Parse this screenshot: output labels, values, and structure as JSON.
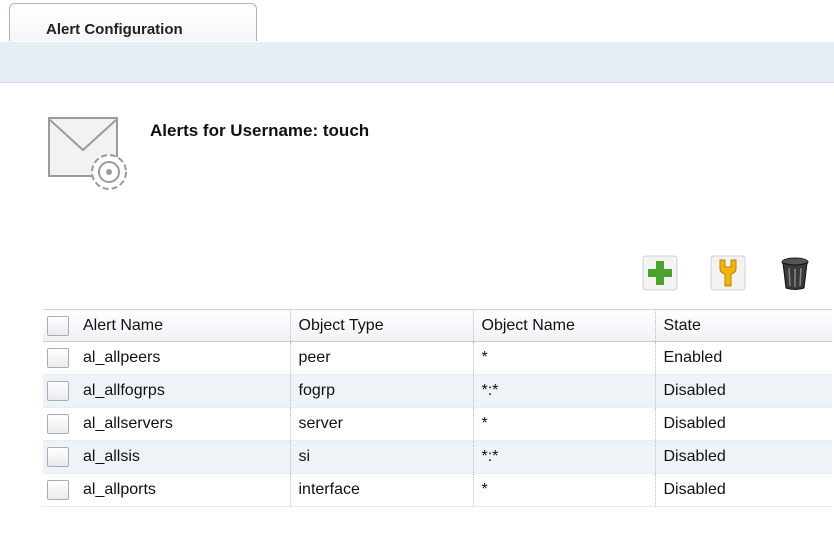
{
  "tab": {
    "label": "Alert Configuration"
  },
  "page": {
    "title": "Alerts for Username: touch"
  },
  "toolbar": {
    "add_icon": "plus-icon",
    "edit_icon": "wrench-icon",
    "delete_icon": "trash-icon"
  },
  "table": {
    "columns": [
      "Alert Name",
      "Object Type",
      "Object Name",
      "State"
    ],
    "rows": [
      {
        "name": "al_allpeers",
        "type": "peer",
        "object": "*",
        "state": "Enabled"
      },
      {
        "name": "al_allfogrps",
        "type": "fogrp",
        "object": "*:*",
        "state": "Disabled"
      },
      {
        "name": "al_allservers",
        "type": "server",
        "object": "*",
        "state": "Disabled"
      },
      {
        "name": "al_allsis",
        "type": "si",
        "object": "*:*",
        "state": "Disabled"
      },
      {
        "name": "al_allports",
        "type": "interface",
        "object": "*",
        "state": "Disabled"
      }
    ]
  },
  "colors": {
    "band": "#e6edf4",
    "row_alt": "#eef3f8",
    "add": "#4aa32a",
    "edit": "#f2b400"
  }
}
